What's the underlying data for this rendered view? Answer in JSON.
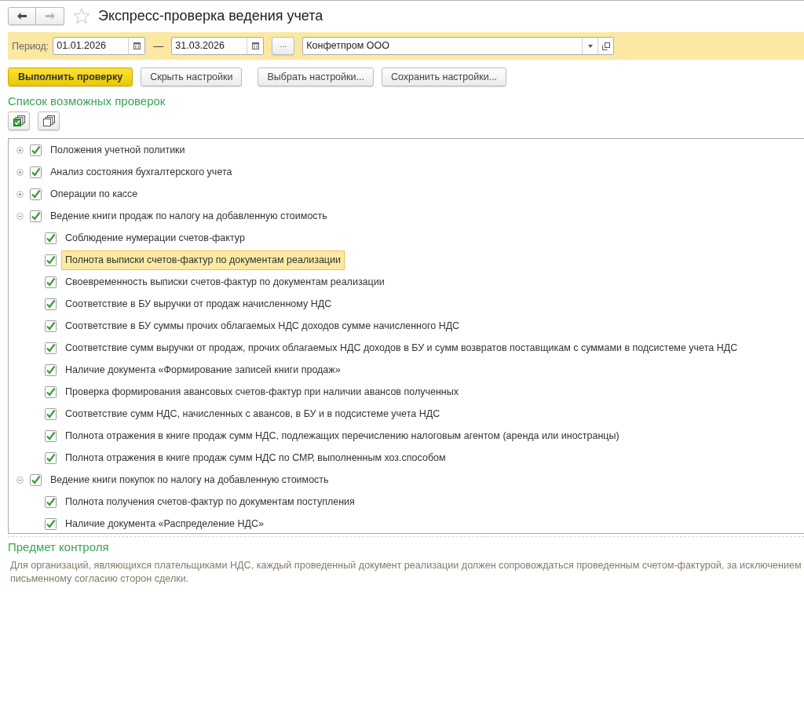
{
  "header": {
    "back_button": {
      "disabled": false
    },
    "forward_button": {
      "disabled": true
    },
    "favorite": false,
    "title": "Экспресс-проверка ведения учета"
  },
  "filter_bar": {
    "period_label": "Период:",
    "date_from": "01.01.2026",
    "separator": "—",
    "date_to": "31.03.2026",
    "period_button": "...",
    "organization": "Конфетпром ООО"
  },
  "actions": [
    {
      "label": "Выполнить проверку",
      "kind": "primary"
    },
    {
      "label": "Скрыть настройки",
      "kind": "default"
    },
    {
      "label": "Выбрать настройки...",
      "kind": "default"
    },
    {
      "label": "Сохранить настройки...",
      "kind": "default"
    }
  ],
  "check_list": {
    "title": "Список возможных проверок",
    "toolbar": [
      {
        "kind": "check_all"
      },
      {
        "kind": "uncheck_all"
      }
    ],
    "items": [
      {
        "label": "Положения учетной политики",
        "checked": true,
        "expanded": false,
        "selected": false
      },
      {
        "label": "Анализ состояния бухгалтерского учета",
        "checked": true,
        "expanded": false,
        "selected": false
      },
      {
        "label": "Операции по кассе",
        "checked": true,
        "expanded": false,
        "selected": false
      },
      {
        "label": "Ведение книги продаж по налогу на добавленную стоимость",
        "checked": true,
        "expanded": true,
        "selected": false,
        "children": [
          {
            "label": "Соблюдение нумерации счетов-фактур",
            "checked": true,
            "selected": false
          },
          {
            "label": "Полнота выписки счетов-фактур по документам реализации",
            "checked": true,
            "selected": true
          },
          {
            "label": "Своевременность выписки счетов-фактур по документам реализации",
            "checked": true,
            "selected": false
          },
          {
            "label": "Соответствие в БУ выручки от продаж начисленному НДС",
            "checked": true,
            "selected": false
          },
          {
            "label": "Соответствие в БУ суммы прочих облагаемых НДС доходов сумме начисленного НДС",
            "checked": true,
            "selected": false
          },
          {
            "label": "Соответствие сумм выручки от продаж, прочих облагаемых НДС доходов в БУ и сумм возвратов поставщикам с суммами в подсистеме учета НДС",
            "checked": true,
            "selected": false
          },
          {
            "label": "Наличие документа «Формирование записей книги продаж»",
            "checked": true,
            "selected": false
          },
          {
            "label": "Проверка формирования авансовых счетов-фактур при наличии авансов полученных",
            "checked": true,
            "selected": false
          },
          {
            "label": "Соответствие сумм НДС, начисленных с авансов, в БУ и в подсистеме учета НДС",
            "checked": true,
            "selected": false
          },
          {
            "label": "Полнота отражения в книге продаж сумм НДС, подлежащих перечислению налоговым агентом (аренда или иностранцы)",
            "checked": true,
            "selected": false
          },
          {
            "label": "Полнота отражения в книге продаж сумм НДС по СМР, выполненным хоз.способом",
            "checked": true,
            "selected": false
          }
        ]
      },
      {
        "label": "Ведение книги покупок по налогу на добавленную стоимость",
        "checked": true,
        "expanded": true,
        "selected": false,
        "children": [
          {
            "label": "Полнота получения счетов-фактур по документам поступления",
            "checked": true,
            "selected": false
          },
          {
            "label": "Наличие документа «Распределение НДС»",
            "checked": true,
            "selected": false
          }
        ]
      }
    ]
  },
  "subject": {
    "title": "Предмет контроля",
    "lines": [
      "Для организаций, являющихся плательщиками НДС, каждый проведенный документ реализации должен сопровождаться проведенным счетом-фактурой, за исключением",
      "письменному согласию сторон сделки."
    ]
  }
}
